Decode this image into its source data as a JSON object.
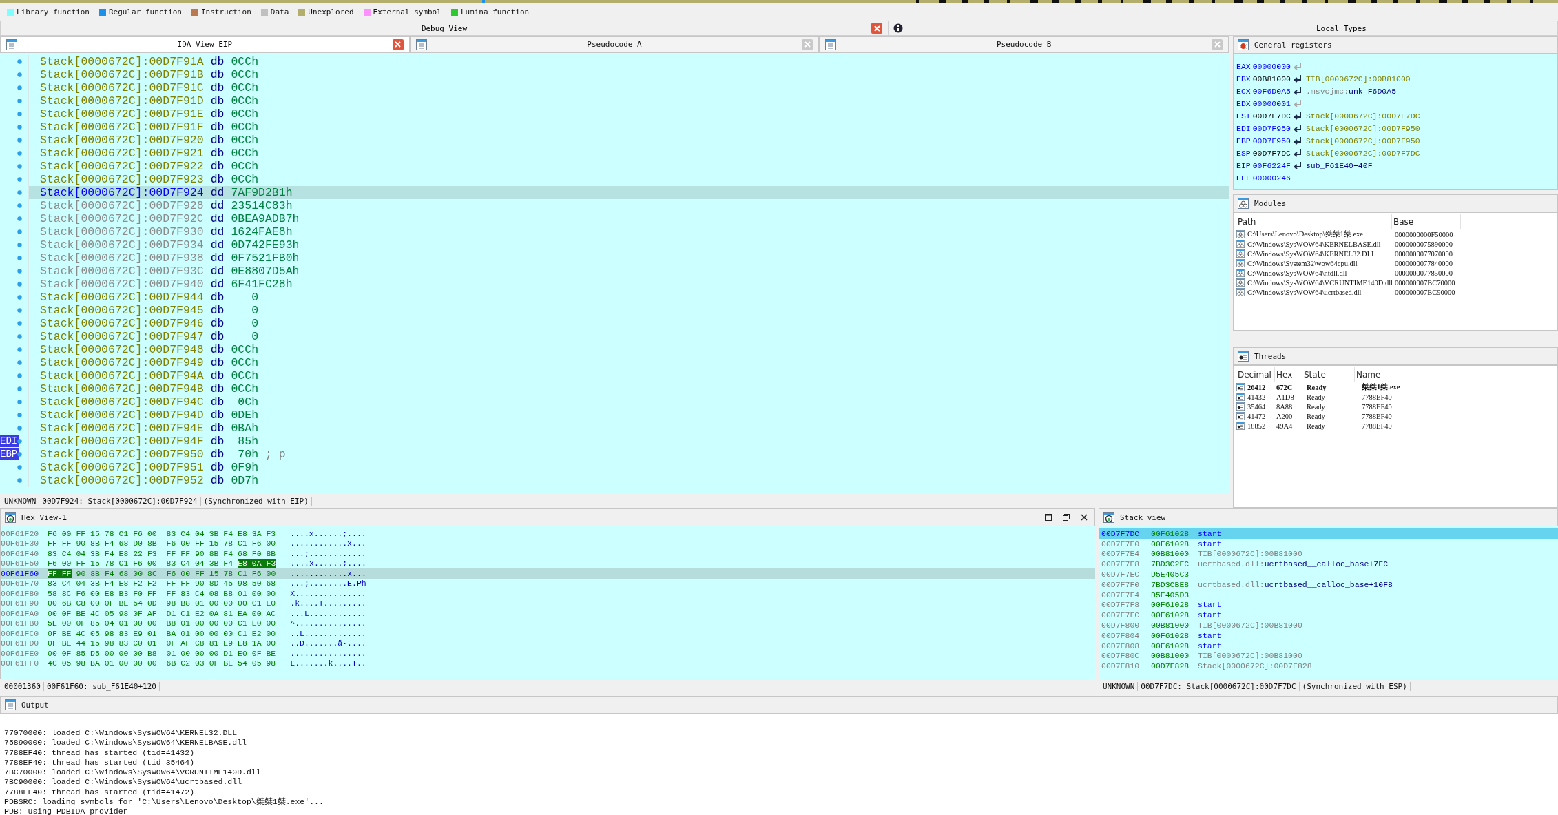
{
  "legend": [
    {
      "label": "Library function",
      "color": "#80ffff"
    },
    {
      "label": "Regular function",
      "color": "#1e90e8"
    },
    {
      "label": "Instruction",
      "color": "#b87850"
    },
    {
      "label": "Data",
      "color": "#c0c0c0"
    },
    {
      "label": "Unexplored",
      "color": "#b4ae6c"
    },
    {
      "label": "External symbol",
      "color": "#ff90ff"
    },
    {
      "label": "Lumina function",
      "color": "#30c830"
    }
  ],
  "debug_view": {
    "title": "Debug View"
  },
  "local_types": {
    "title": "Local Types"
  },
  "tabs": [
    {
      "label": "IDA View-EIP",
      "selected": true
    },
    {
      "label": "Pseudocode-A",
      "selected": false
    },
    {
      "label": "Pseudocode-B",
      "selected": false
    }
  ],
  "listing": {
    "lines": [
      {
        "address": "Stack[0000672C]:00D7F91A",
        "directive": "db",
        "operand": "0CCh",
        "selected": false,
        "greyed": false
      },
      {
        "address": "Stack[0000672C]:00D7F91B",
        "directive": "db",
        "operand": "0CCh",
        "selected": false,
        "greyed": false
      },
      {
        "address": "Stack[0000672C]:00D7F91C",
        "directive": "db",
        "operand": "0CCh",
        "selected": false,
        "greyed": false
      },
      {
        "address": "Stack[0000672C]:00D7F91D",
        "directive": "db",
        "operand": "0CCh",
        "selected": false,
        "greyed": false
      },
      {
        "address": "Stack[0000672C]:00D7F91E",
        "directive": "db",
        "operand": "0CCh",
        "selected": false,
        "greyed": false
      },
      {
        "address": "Stack[0000672C]:00D7F91F",
        "directive": "db",
        "operand": "0CCh",
        "selected": false,
        "greyed": false
      },
      {
        "address": "Stack[0000672C]:00D7F920",
        "directive": "db",
        "operand": "0CCh",
        "selected": false,
        "greyed": false
      },
      {
        "address": "Stack[0000672C]:00D7F921",
        "directive": "db",
        "operand": "0CCh",
        "selected": false,
        "greyed": false
      },
      {
        "address": "Stack[0000672C]:00D7F922",
        "directive": "db",
        "operand": "0CCh",
        "selected": false,
        "greyed": false
      },
      {
        "address": "Stack[0000672C]:00D7F923",
        "directive": "db",
        "operand": "0CCh",
        "selected": false,
        "greyed": false
      },
      {
        "address": "Stack[0000672C]:00D7F924",
        "directive": "dd",
        "operand": "7AF9D2B1h",
        "selected": true,
        "greyed": false
      },
      {
        "address": "Stack[0000672C]:00D7F928",
        "directive": "dd",
        "operand": "23514C83h",
        "selected": false,
        "greyed": true
      },
      {
        "address": "Stack[0000672C]:00D7F92C",
        "directive": "dd",
        "operand": "0BEA9ADB7h",
        "selected": false,
        "greyed": true
      },
      {
        "address": "Stack[0000672C]:00D7F930",
        "directive": "dd",
        "operand": "1624FAE8h",
        "selected": false,
        "greyed": true
      },
      {
        "address": "Stack[0000672C]:00D7F934",
        "directive": "dd",
        "operand": "0D742FE93h",
        "selected": false,
        "greyed": true
      },
      {
        "address": "Stack[0000672C]:00D7F938",
        "directive": "dd",
        "operand": "0F7521FB0h",
        "selected": false,
        "greyed": true
      },
      {
        "address": "Stack[0000672C]:00D7F93C",
        "directive": "dd",
        "operand": "0E8807D5Ah",
        "selected": false,
        "greyed": true
      },
      {
        "address": "Stack[0000672C]:00D7F940",
        "directive": "dd",
        "operand": "6F41FC28h",
        "selected": false,
        "greyed": true
      },
      {
        "address": "Stack[0000672C]:00D7F944",
        "directive": "db",
        "operand": "0",
        "selected": false,
        "greyed": false
      },
      {
        "address": "Stack[0000672C]:00D7F945",
        "directive": "db",
        "operand": "0",
        "selected": false,
        "greyed": false
      },
      {
        "address": "Stack[0000672C]:00D7F946",
        "directive": "db",
        "operand": "0",
        "selected": false,
        "greyed": false
      },
      {
        "address": "Stack[0000672C]:00D7F947",
        "directive": "db",
        "operand": "0",
        "selected": false,
        "greyed": false
      },
      {
        "address": "Stack[0000672C]:00D7F948",
        "directive": "db",
        "operand": "0CCh",
        "selected": false,
        "greyed": false
      },
      {
        "address": "Stack[0000672C]:00D7F949",
        "directive": "db",
        "operand": "0CCh",
        "selected": false,
        "greyed": false
      },
      {
        "address": "Stack[0000672C]:00D7F94A",
        "directive": "db",
        "operand": "0CCh",
        "selected": false,
        "greyed": false
      },
      {
        "address": "Stack[0000672C]:00D7F94B",
        "directive": "db",
        "operand": "0CCh",
        "selected": false,
        "greyed": false
      },
      {
        "address": "Stack[0000672C]:00D7F94C",
        "directive": "db",
        "operand": "0Ch",
        "selected": false,
        "greyed": false
      },
      {
        "address": "Stack[0000672C]:00D7F94D",
        "directive": "db",
        "operand": "0DEh",
        "selected": false,
        "greyed": false
      },
      {
        "address": "Stack[0000672C]:00D7F94E",
        "directive": "db",
        "operand": "0BAh",
        "selected": false,
        "greyed": false
      },
      {
        "address": "Stack[0000672C]:00D7F94F",
        "directive": "db",
        "operand": "85h",
        "selected": false,
        "greyed": false,
        "register": "EDI"
      },
      {
        "address": "Stack[0000672C]:00D7F950",
        "directive": "db",
        "operand": "70h",
        "comment": "; p",
        "selected": false,
        "greyed": false,
        "register": "EBP"
      },
      {
        "address": "Stack[0000672C]:00D7F951",
        "directive": "db",
        "operand": "0F9h",
        "selected": false,
        "greyed": false
      },
      {
        "address": "Stack[0000672C]:00D7F952",
        "directive": "db",
        "operand": "0D7h",
        "selected": false,
        "greyed": false
      }
    ],
    "status": [
      "UNKNOWN",
      "00D7F924: Stack[0000672C]:00D7F924",
      "(Synchronized with EIP)"
    ]
  },
  "registers": {
    "title": "General registers",
    "items": [
      {
        "name": "EAX",
        "value": "00000000",
        "changed": true,
        "kind": "value"
      },
      {
        "name": "EBX",
        "value": "00B81000",
        "changed": false,
        "kind": "pointer",
        "target": [
          {
            "text": "TIB[0000672C]:00B81000",
            "kind": "data"
          }
        ]
      },
      {
        "name": "ECX",
        "value": "00F6D0A5",
        "changed": true,
        "kind": "pointer",
        "target": [
          {
            "text": ".msvcjmc:",
            "kind": "segment"
          },
          {
            "text": "unk_F6D0A5",
            "kind": "name"
          }
        ]
      },
      {
        "name": "EDX",
        "value": "00000001",
        "changed": true,
        "kind": "value"
      },
      {
        "name": "ESI",
        "value": "00D7F7DC",
        "changed": false,
        "kind": "pointer",
        "target": [
          {
            "text": "Stack[0000672C]:00D7F7DC",
            "kind": "data"
          }
        ]
      },
      {
        "name": "EDI",
        "value": "00D7F950",
        "changed": true,
        "kind": "pointer",
        "target": [
          {
            "text": "Stack[0000672C]:00D7F950",
            "kind": "data"
          }
        ]
      },
      {
        "name": "EBP",
        "value": "00D7F950",
        "changed": true,
        "kind": "pointer",
        "target": [
          {
            "text": "Stack[0000672C]:00D7F950",
            "kind": "data"
          }
        ]
      },
      {
        "name": "ESP",
        "value": "00D7F7DC",
        "changed": false,
        "kind": "pointer",
        "target": [
          {
            "text": "Stack[0000672C]:00D7F7DC",
            "kind": "data"
          }
        ]
      },
      {
        "name": "EIP",
        "value": "00F6224F",
        "changed": true,
        "kind": "pointer",
        "target": [
          {
            "text": "sub_F61E40+40F",
            "kind": "name"
          }
        ]
      },
      {
        "name": "EFL",
        "value": "00000246",
        "changed": true,
        "kind": "flags"
      }
    ]
  },
  "modules": {
    "title": "Modules",
    "columns": [
      "Path",
      "Base"
    ],
    "rows": [
      {
        "path": "C:\\Users\\Lenovo\\Desktop\\桀桀1桀.exe",
        "base": "0000000000F50000"
      },
      {
        "path": "C:\\Windows\\SysWOW64\\KERNELBASE.dll",
        "base": "0000000075890000"
      },
      {
        "path": "C:\\Windows\\SysWOW64\\KERNEL32.DLL",
        "base": "0000000077070000"
      },
      {
        "path": "C:\\Windows\\System32\\wow64cpu.dll",
        "base": "0000000077840000"
      },
      {
        "path": "C:\\Windows\\SysWOW64\\ntdll.dll",
        "base": "0000000077850000"
      },
      {
        "path": "C:\\Windows\\SysWOW64\\VCRUNTIME140D.dll",
        "base": "000000007BC70000"
      },
      {
        "path": "C:\\Windows\\SysWOW64\\ucrtbased.dll",
        "base": "000000007BC90000"
      }
    ]
  },
  "threads": {
    "title": "Threads",
    "columns": [
      "Decimal",
      "Hex",
      "State",
      "Name"
    ],
    "rows": [
      {
        "decimal": "26412",
        "hex": "672C",
        "state": "Ready",
        "name": "桀桀1桀.exe",
        "current": true
      },
      {
        "decimal": "41432",
        "hex": "A1D8",
        "state": "Ready",
        "name": "7788EF40",
        "current": false
      },
      {
        "decimal": "35464",
        "hex": "8A88",
        "state": "Ready",
        "name": "7788EF40",
        "current": false
      },
      {
        "decimal": "41472",
        "hex": "A200",
        "state": "Ready",
        "name": "7788EF40",
        "current": false
      },
      {
        "decimal": "18852",
        "hex": "49A4",
        "state": "Ready",
        "name": "7788EF40",
        "current": false
      }
    ]
  },
  "hex_view": {
    "title": "Hex View-1",
    "rows": [
      {
        "address": "00F61F20",
        "segments": [
          {
            "text": "F6 00 FF 15 78 C1 F6 00  83 C4 04 3B F4 E8 3A F3",
            "marked": false
          }
        ],
        "ascii": "....x......;....",
        "selected": false
      },
      {
        "address": "00F61F30",
        "segments": [
          {
            "text": "FF FF 90 8B F4 68 D0 8B  F6 00 FF 15 78 C1 F6 00",
            "marked": false
          }
        ],
        "ascii": "............x...",
        "selected": false
      },
      {
        "address": "00F61F40",
        "segments": [
          {
            "text": "83 C4 04 3B F4 E8 22 F3  FF FF 90 8B F4 68 F0 8B",
            "marked": false
          }
        ],
        "ascii": "...;............",
        "selected": false
      },
      {
        "address": "00F61F50",
        "segments": [
          {
            "text": "F6 00 FF 15 78 C1 F6 00  83 C4 04 3B F4",
            "marked": false
          },
          {
            "text": "E8 0A F3",
            "marked": true
          }
        ],
        "ascii": "....x......;....",
        "selected": false
      },
      {
        "address": "00F61F60",
        "segments": [
          {
            "text": "FF FF",
            "marked": true
          },
          {
            "text": "90 8B F4 68 00 8C  F6 00 FF 15 78 C1 F6 00",
            "marked": false
          }
        ],
        "ascii": "............x...",
        "selected": true
      },
      {
        "address": "00F61F70",
        "segments": [
          {
            "text": "83 C4 04 3B F4 E8 F2 F2  FF FF 90 8D 45 98 50 68",
            "marked": false
          }
        ],
        "ascii": "...;........E.Ph",
        "selected": false
      },
      {
        "address": "00F61F80",
        "segments": [
          {
            "text": "58 8C F6 00 E8 B3 F0 FF  FF 83 C4 08 B8 01 00 00",
            "marked": false
          }
        ],
        "ascii": "X...............",
        "selected": false
      },
      {
        "address": "00F61F90",
        "segments": [
          {
            "text": "00 6B C8 00 0F BE 54 0D  98 B8 01 00 00 00 C1 E0",
            "marked": false
          }
        ],
        "ascii": ".k....T.........",
        "selected": false
      },
      {
        "address": "00F61FA0",
        "segments": [
          {
            "text": "00 0F BE 4C 05 98 0F AF  D1 C1 E2 0A 81 EA 00 AC",
            "marked": false
          }
        ],
        "ascii": "...L............",
        "selected": false
      },
      {
        "address": "00F61FB0",
        "segments": [
          {
            "text": "5E 00 0F 85 04 01 00 00  B8 01 00 00 00 C1 E0 00",
            "marked": false
          }
        ],
        "ascii": "^...............",
        "selected": false
      },
      {
        "address": "00F61FC0",
        "segments": [
          {
            "text": "0F BE 4C 05 98 83 E9 01  BA 01 00 00 00 C1 E2 00",
            "marked": false
          }
        ],
        "ascii": "..L.............",
        "selected": false
      },
      {
        "address": "00F61FD0",
        "segments": [
          {
            "text": "0F BE 44 15 98 83 C0 01  0F AF C8 81 E9 E8 1A 00",
            "marked": false
          }
        ],
        "ascii": "..D.......ä·....",
        "selected": false
      },
      {
        "address": "00F61FE0",
        "segments": [
          {
            "text": "00 0F 85 D5 00 00 00 B8  01 00 00 00 D1 E0 0F BE",
            "marked": false
          }
        ],
        "ascii": "................",
        "selected": false
      },
      {
        "address": "00F61FF0",
        "segments": [
          {
            "text": "4C 05 98 BA 01 00 00 00  6B C2 03 0F BE 54 05 98",
            "marked": false
          }
        ],
        "ascii": "L.......k....T..",
        "selected": false
      }
    ],
    "status": [
      "00001360",
      "00F61F60: sub_F61E40+120"
    ]
  },
  "stack_view": {
    "title": "Stack view",
    "rows": [
      {
        "address": "00D7F7DC",
        "value": "00F61028",
        "target": [
          {
            "text": "start",
            "kind": "code"
          }
        ],
        "selected": true
      },
      {
        "address": "00D7F7E0",
        "value": "00F61028",
        "target": [
          {
            "text": "start",
            "kind": "code"
          }
        ],
        "selected": false
      },
      {
        "address": "00D7F7E4",
        "value": "00B81000",
        "target": [
          {
            "text": "TIB[0000672C]:00B81000",
            "kind": "plain"
          }
        ],
        "selected": false
      },
      {
        "address": "00D7F7E8",
        "value": "7BD3C2EC",
        "target": [
          {
            "text": "ucrtbased.dll:",
            "kind": "plain"
          },
          {
            "text": "ucrtbased__calloc_base+7FC",
            "kind": "import"
          }
        ],
        "selected": false
      },
      {
        "address": "00D7F7EC",
        "value": "D5E405C3",
        "selected": false
      },
      {
        "address": "00D7F7F0",
        "value": "7BD3CBE8",
        "target": [
          {
            "text": "ucrtbased.dll:",
            "kind": "plain"
          },
          {
            "text": "ucrtbased__calloc_base+10F8",
            "kind": "import"
          }
        ],
        "selected": false
      },
      {
        "address": "00D7F7F4",
        "value": "D5E405D3",
        "selected": false
      },
      {
        "address": "00D7F7F8",
        "value": "00F61028",
        "target": [
          {
            "text": "start",
            "kind": "code"
          }
        ],
        "selected": false
      },
      {
        "address": "00D7F7FC",
        "value": "00F61028",
        "target": [
          {
            "text": "start",
            "kind": "code"
          }
        ],
        "selected": false
      },
      {
        "address": "00D7F800",
        "value": "00B81000",
        "target": [
          {
            "text": "TIB[0000672C]:00B81000",
            "kind": "plain"
          }
        ],
        "selected": false
      },
      {
        "address": "00D7F804",
        "value": "00F61028",
        "target": [
          {
            "text": "start",
            "kind": "code"
          }
        ],
        "selected": false
      },
      {
        "address": "00D7F808",
        "value": "00F61028",
        "target": [
          {
            "text": "start",
            "kind": "code"
          }
        ],
        "selected": false
      },
      {
        "address": "00D7F80C",
        "value": "00B81000",
        "target": [
          {
            "text": "TIB[0000672C]:00B81000",
            "kind": "plain"
          }
        ],
        "selected": false
      },
      {
        "address": "00D7F810",
        "value": "00D7F828",
        "target": [
          {
            "text": "Stack[0000672C]:00D7F828",
            "kind": "plain"
          }
        ],
        "selected": false
      }
    ],
    "status": [
      "UNKNOWN",
      "00D7F7DC: Stack[0000672C]:00D7F7DC",
      "(Synchronized with ESP)"
    ]
  },
  "output": {
    "title": "Output",
    "lines": [
      "77070000: loaded C:\\Windows\\SysWOW64\\KERNEL32.DLL",
      "75890000: loaded C:\\Windows\\SysWOW64\\KERNELBASE.dll",
      "7788EF40: thread has started (tid=41432)",
      "7788EF40: thread has started (tid=35464)",
      "7BC70000: loaded C:\\Windows\\SysWOW64\\VCRUNTIME140D.dll",
      "7BC90000: loaded C:\\Windows\\SysWOW64\\ucrtbased.dll",
      "7788EF40: thread has started (tid=41472)",
      "PDBSRC: loading symbols for 'C:\\Users\\Lenovo\\Desktop\\桀桀1桀.exe'...",
      "PDB: using PDBIDA provider"
    ]
  }
}
